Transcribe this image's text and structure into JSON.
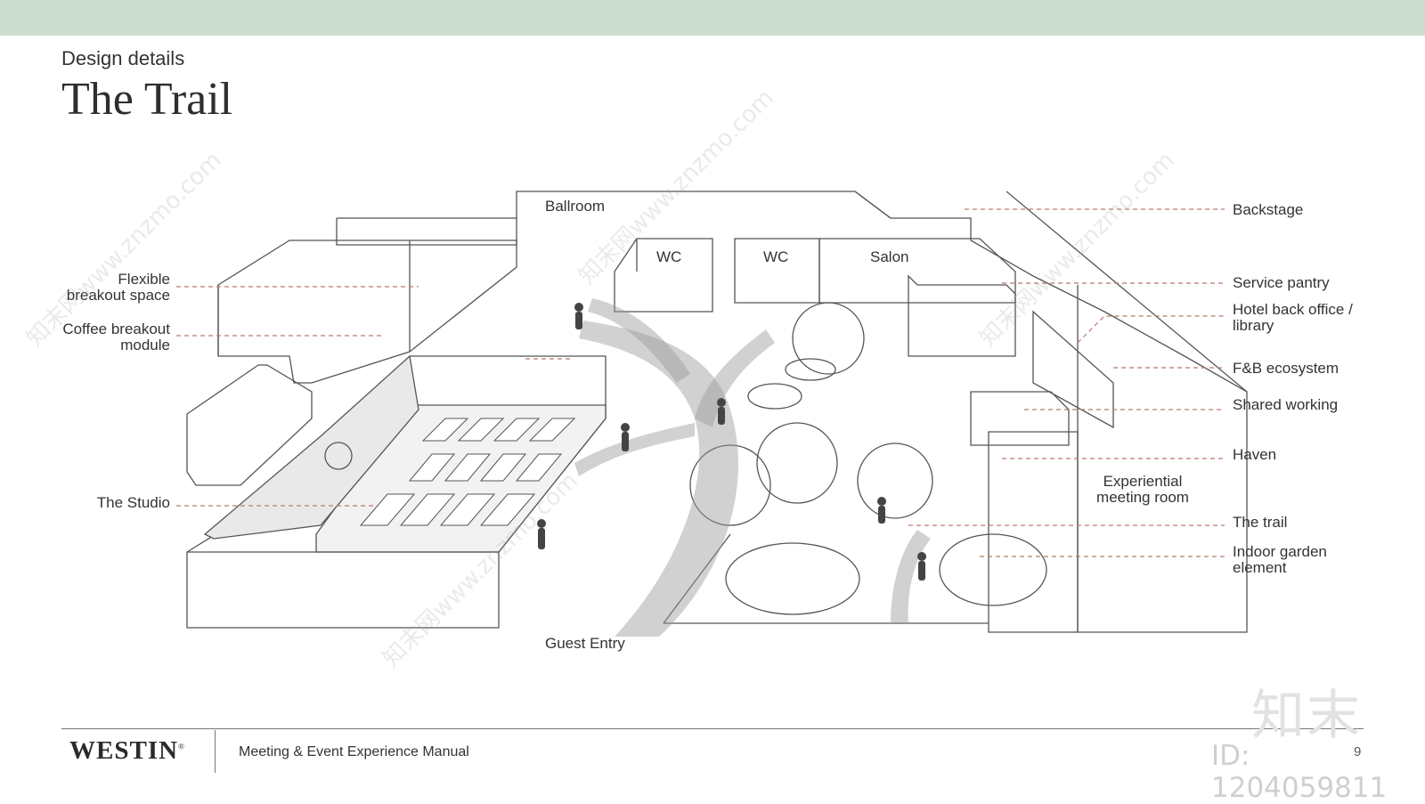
{
  "header": {
    "subtitle": "Design details",
    "title": "The Trail"
  },
  "plan_labels": {
    "ballroom": "Ballroom",
    "wc_1": "WC",
    "wc_2": "WC",
    "salon": "Salon",
    "guest_entry": "Guest Entry",
    "experiential_line1": "Experiential",
    "experiential_line2": "meeting room"
  },
  "left_callouts": [
    {
      "line1": "Flexible",
      "line2": "breakout space"
    },
    {
      "line1": "Coffee breakout",
      "line2": "module"
    },
    {
      "line1": "The Studio",
      "line2": ""
    }
  ],
  "right_callouts": [
    {
      "line1": "Backstage",
      "line2": ""
    },
    {
      "line1": "Service pantry",
      "line2": ""
    },
    {
      "line1": "Hotel back office /",
      "line2": "library"
    },
    {
      "line1": "F&B ecosystem",
      "line2": ""
    },
    {
      "line1": "Shared working",
      "line2": ""
    },
    {
      "line1": "Haven",
      "line2": ""
    },
    {
      "line1": "The trail",
      "line2": ""
    },
    {
      "line1": "Indoor garden",
      "line2": "element"
    }
  ],
  "footer": {
    "brand": "WESTIN",
    "brand_mark": "®",
    "manual": "Meeting & Event Experience Manual",
    "page": "9"
  },
  "watermark": {
    "logo": "知末",
    "id": "ID: 1204059811",
    "site": "知末网www.znzmo.com"
  },
  "colors": {
    "top_band": "#cdddd2",
    "leader": "#b9786f",
    "line": "#555555"
  }
}
